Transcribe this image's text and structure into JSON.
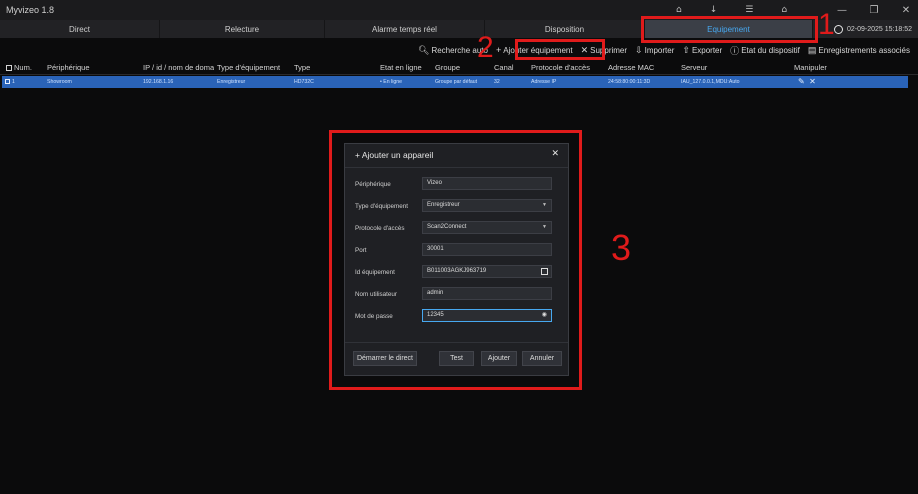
{
  "window": {
    "title": "Myvizeo 1.8",
    "controls": [
      "—",
      "❐",
      "✕"
    ]
  },
  "top_icons": [
    "⌂",
    "↓",
    "☰",
    "⌂"
  ],
  "nav": {
    "tabs": [
      {
        "label": "Direct"
      },
      {
        "label": "Relecture"
      },
      {
        "label": "Alarme temps réel"
      },
      {
        "label": "Disposition"
      },
      {
        "label": "Equipement"
      }
    ],
    "datetime": "02-09-2025 15:18:52"
  },
  "toolbar": {
    "search": "Recherche auto",
    "add": "Ajouter équipement",
    "delete": "Supprimer",
    "import": "Importer",
    "export": "Exporter",
    "status": "Etat du dispositif",
    "linked": "Enregistrements associés"
  },
  "table": {
    "headers": [
      "Num.",
      "Périphérique",
      "IP / id / nom de domaine",
      "Type d'équipement",
      "Type",
      "Etat en ligne",
      "Groupe",
      "Canal",
      "Protocole d'accès",
      "Adresse MAC",
      "Serveur",
      "Manipuler"
    ],
    "rows": [
      {
        "num": "1",
        "device": "Showroom",
        "ip": "192.168.1.16",
        "equip_type": "Enregistreur",
        "type": "HD732C",
        "status": "En ligne",
        "group": "Groupe par défaut",
        "channel": "32",
        "protocol": "Adresse IP",
        "mac": "24:58:80:00:11:3D",
        "server": "IAU_127.0.0.1,MDU:Auto"
      }
    ]
  },
  "annotations": {
    "n1": "1",
    "n2": "2",
    "n3": "3"
  },
  "dialog": {
    "title": "Ajouter un appareil",
    "fields": {
      "device_label": "Périphérique",
      "device_value": "Vizeo",
      "equip_type_label": "Type d'équipement",
      "equip_type_value": "Enregistreur",
      "protocol_label": "Protocole d'accès",
      "protocol_value": "Scan2Connect",
      "port_label": "Port",
      "port_value": "30001",
      "id_label": "Id équipement",
      "id_value": "B011003AGKJ963719",
      "user_label": "Nom utilisateur",
      "user_value": "admin",
      "password_label": "Mot de passe",
      "password_value": "12345"
    },
    "buttons": {
      "live": "Démarrer le direct",
      "test": "Test",
      "add": "Ajouter",
      "cancel": "Annuler"
    }
  },
  "colors": {
    "accent": "#47a8f0",
    "selection": "#2a63b8",
    "annotation_red": "#e01b1b"
  }
}
